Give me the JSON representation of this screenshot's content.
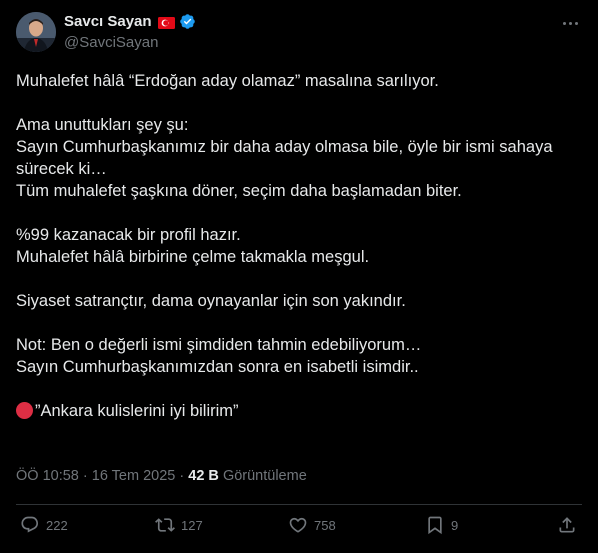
{
  "author": {
    "display_name": "Savcı Sayan",
    "handle": "@SavciSayan",
    "flag_icon": "turkey-flag-icon",
    "verified_icon": "verified-badge-icon"
  },
  "tweet": {
    "lines": [
      "Muhalefet hâlâ “Erdoğan aday olamaz” masalına sarılıyor.",
      "",
      "Ama unuttukları şey şu:",
      "Sayın Cumhurbaşkanımız bir daha aday olmasa bile, öyle bir ismi sahaya",
      "sürecek ki…",
      "Tüm muhalefet şaşkına döner, seçim daha başlamadan biter.",
      "",
      "%99 kazanacak bir profil hazır.",
      "Muhalefet hâlâ birbirine çelme takmakla meşgul.",
      "",
      "Siyaset satrançtır, dama oynayanlar için son yakındır.",
      "",
      "Not: Ben o değerli ismi şimdiden tahmin edebiliyorum…",
      "Sayın Cumhurbaşkanımızdan sonra en isabetli isimdir..",
      ""
    ],
    "last_line": "”Ankara kulislerini iyi bilirim”",
    "last_line_icon": "red-circle-emoji-icon"
  },
  "meta": {
    "time": "ÖÖ 10:58",
    "separator": "·",
    "date": "16 Tem 2025",
    "views_count": "42 B",
    "views_label": "Görüntüleme"
  },
  "actions": {
    "replies": "222",
    "reposts": "127",
    "likes": "758",
    "bookmarks": "9"
  },
  "colors": {
    "background": "#000000",
    "text": "#e7e9ea",
    "secondary": "#71767b",
    "verified": "#1d9bf0",
    "flag": "#e30a17"
  }
}
